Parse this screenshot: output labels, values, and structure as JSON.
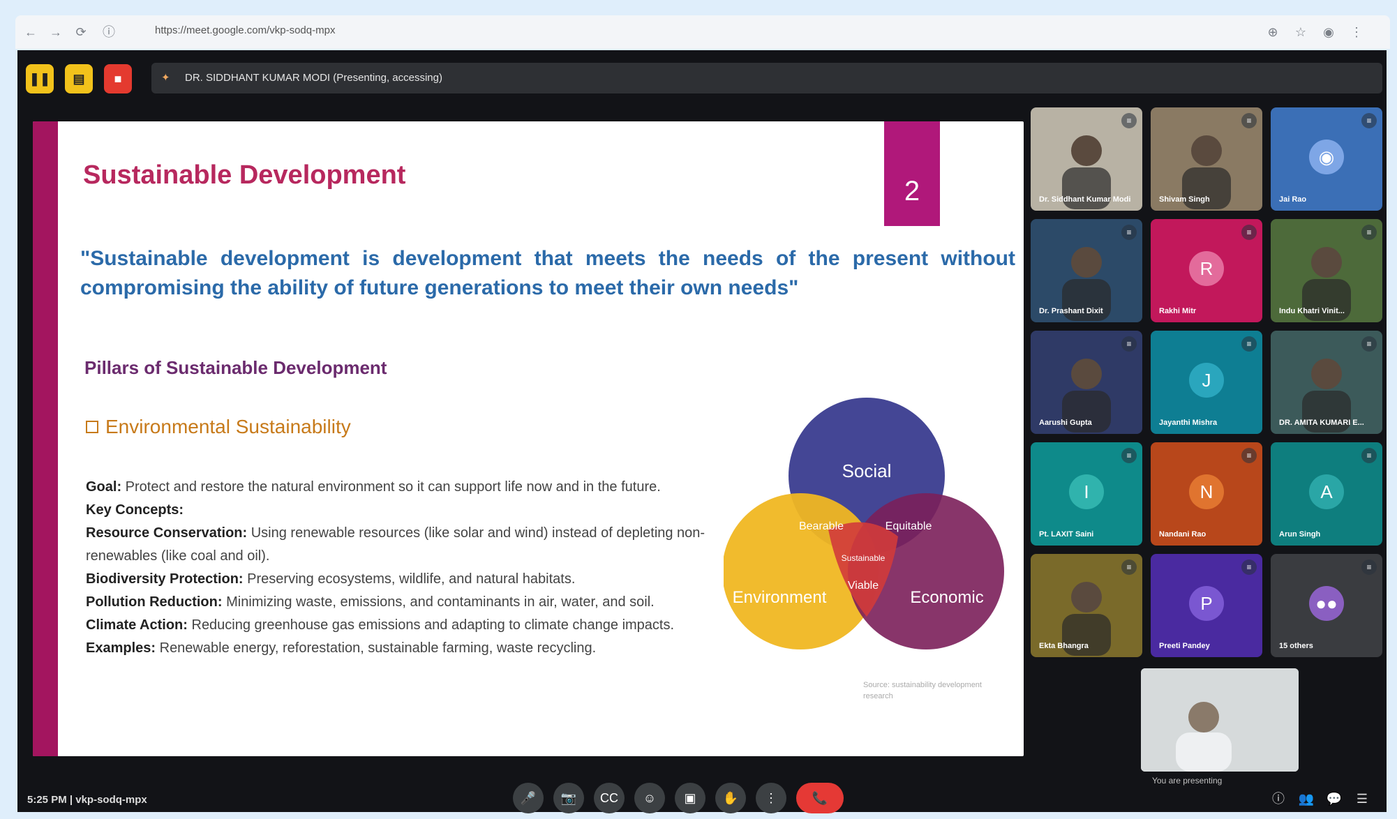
{
  "browser": {
    "url": "https://meet.google.com/vkp-sodq-mpx"
  },
  "meet": {
    "presenting_banner": "DR. SIDDHANT KUMAR MODI (Presenting, accessing)",
    "slide": {
      "number": "2",
      "title": "Sustainable Development",
      "quote": "\"Sustainable development is development that meets the needs of the present without compromising the ability of future generations to meet their own needs\"",
      "pillars_heading": "Pillars of Sustainable Development",
      "env_heading": "Environmental Sustainability",
      "body": [
        {
          "label": "Goal:",
          "text": " Protect and restore the natural environment so it can support life now and in the future."
        },
        {
          "label": "Key Concepts:",
          "text": ""
        },
        {
          "label": "Resource Conservation:",
          "text": " Using renewable resources (like solar and wind) instead of depleting non-renewables (like coal and oil)."
        },
        {
          "label": "Biodiversity Protection:",
          "text": " Preserving ecosystems, wildlife, and natural habitats."
        },
        {
          "label": "Pollution Reduction:",
          "text": " Minimizing waste, emissions, and contaminants in air, water, and soil."
        },
        {
          "label": "Climate Action:",
          "text": " Reducing greenhouse gas emissions and adapting to climate change impacts."
        },
        {
          "label": "Examples:",
          "text": " Renewable energy, reforestation, sustainable farming, waste recycling."
        }
      ],
      "venn": {
        "social": "Social",
        "environment": "Environment",
        "economic": "Economic",
        "bearable": "Bearable",
        "equitable": "Equitable",
        "viable": "Viable",
        "sustainable": "Sustainable"
      },
      "source_text": "Source: sustainability development research"
    },
    "participants": [
      {
        "name": "Dr. Siddhant Kumar Modi",
        "kind": "video",
        "bg": "#b8b2a4"
      },
      {
        "name": "Shivam Singh",
        "kind": "video",
        "bg": "#8a7a63"
      },
      {
        "name": "Jai Rao",
        "kind": "avatar",
        "initial": "",
        "bg": "#3b6fb6",
        "avatar_bg": "#7ea6e6"
      },
      {
        "name": "Dr. Prashant Dixit",
        "kind": "video",
        "bg": "#2c4a68"
      },
      {
        "name": "Rakhi Mitr",
        "kind": "avatar",
        "initial": "R",
        "bg": "#c2185b",
        "avatar_bg": "#e36b9b"
      },
      {
        "name": "Indu Khatri Vinit...",
        "kind": "video",
        "bg": "#4d6a3a"
      },
      {
        "name": "Aarushi Gupta",
        "kind": "video",
        "bg": "#2f3a66"
      },
      {
        "name": "Jayanthi Mishra",
        "kind": "avatar",
        "initial": "J",
        "bg": "#0e7e93",
        "avatar_bg": "#2aa6bd"
      },
      {
        "name": "DR. AMITA KUMARI E...",
        "kind": "video",
        "bg": "#3c5a5a"
      },
      {
        "name": "Pt. LAXIT Saini",
        "kind": "avatar",
        "initial": "I",
        "bg": "#0e8a8a",
        "avatar_bg": "#30b3ad"
      },
      {
        "name": "Nandani Rao",
        "kind": "avatar",
        "initial": "N",
        "bg": "#b8471b",
        "avatar_bg": "#e0742f"
      },
      {
        "name": "Arun Singh",
        "kind": "avatar",
        "initial": "A",
        "bg": "#0e7e7e",
        "avatar_bg": "#2aa6a6"
      },
      {
        "name": "Ekta Bhangra",
        "kind": "video",
        "bg": "#7a6a2a"
      },
      {
        "name": "Preeti Pandey",
        "kind": "avatar",
        "initial": "P",
        "bg": "#4a2aa0",
        "avatar_bg": "#7a57d1"
      },
      {
        "name": "15 others",
        "kind": "others",
        "bg": "#3a3c40"
      }
    ],
    "self_view_label": "You are presenting",
    "clock": "5:25 PM  |  vkp-sodq-mpx",
    "controls": {
      "raise_hand": "✋",
      "mic": "🎤",
      "camera": "📷",
      "captions": "CC",
      "emoji": "☺",
      "present": "▣",
      "hand": "✋",
      "more": "⋮",
      "end_call": "📞"
    },
    "right_controls": [
      "ⓘ",
      "👥",
      "💬",
      "☰"
    ],
    "colors": {
      "slide_accent": "#a3155f",
      "title": "#b7285e",
      "quote": "#2b6aa9",
      "end_call": "#e53935"
    }
  }
}
